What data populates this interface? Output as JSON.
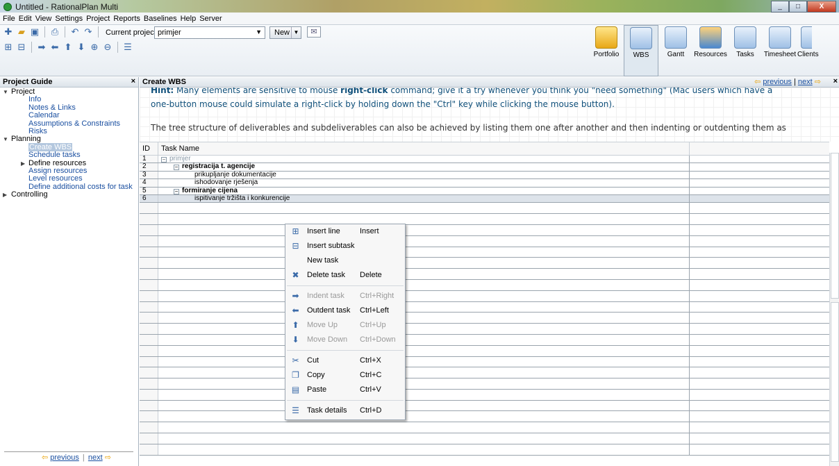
{
  "window": {
    "title": "Untitled - RationalPlan Multi",
    "minimize": "_",
    "maximize": "□",
    "close": "X"
  },
  "menu": [
    "File",
    "Edit",
    "View",
    "Settings",
    "Project",
    "Reports",
    "Baselines",
    "Help",
    "Server"
  ],
  "toolbar": {
    "current_project_label": "Current project:",
    "current_project_value": "primjer",
    "new_label": "New"
  },
  "views": [
    {
      "id": "portfolio",
      "label": "Portfolio"
    },
    {
      "id": "wbs",
      "label": "WBS"
    },
    {
      "id": "gantt",
      "label": "Gantt"
    },
    {
      "id": "resources",
      "label": "Resources"
    },
    {
      "id": "tasks",
      "label": "Tasks"
    },
    {
      "id": "timesheet",
      "label": "Timesheet"
    },
    {
      "id": "clients",
      "label": "Clients"
    }
  ],
  "project_guide": {
    "title": "Project Guide",
    "close": "×",
    "sections": [
      {
        "label": "Project",
        "items": [
          "Info",
          "Notes & Links",
          "Calendar",
          "Assumptions & Constraints",
          "Risks"
        ]
      },
      {
        "label": "Planning",
        "items": [
          "Create WBS",
          "Schedule tasks",
          "Define resources",
          "Assign resources",
          "Level resources",
          "Define additional costs for task"
        ]
      },
      {
        "label": "Controlling",
        "items": []
      }
    ],
    "nav": {
      "previous": "previous",
      "next": "next",
      "separator": "|"
    }
  },
  "main": {
    "title": "Create WBS",
    "nav": {
      "previous": "previous",
      "next": "next",
      "separator": "|"
    },
    "close": "×",
    "hint": {
      "prefix": "Hint:",
      "text_a": " Many elements are sensitive to mouse ",
      "bold": "right-click",
      "text_b": " command; give it a try whenever you think you \"need something\" (Mac users which have a",
      "line2": "one-button mouse could simulate a right-click by holding down the \"Ctrl\" key while clicking the mouse button).",
      "line3": "The tree structure of deliverables and subdeliverables can also be achieved by listing them one after another and then indenting or outdenting them as"
    }
  },
  "grid": {
    "headers": {
      "id": "ID",
      "name": "Task Name"
    },
    "rows": [
      {
        "id": "1",
        "name": "primjer"
      },
      {
        "id": "2",
        "name": "registracija t. agencije"
      },
      {
        "id": "3",
        "name": "prikupljanje dokumentacije"
      },
      {
        "id": "4",
        "name": "ishodovanje rješenja"
      },
      {
        "id": "5",
        "name": "formiranje cijena"
      },
      {
        "id": "6",
        "name": "ispitivanje tržišta i konkurencije"
      }
    ]
  },
  "context_menu": [
    {
      "label": "Insert line",
      "shortcut": "Insert",
      "icon": "insert-line-icon"
    },
    {
      "label": "Insert subtask",
      "shortcut": "",
      "icon": "insert-subtask-icon"
    },
    {
      "label": "New task",
      "shortcut": "",
      "icon": ""
    },
    {
      "label": "Delete task",
      "shortcut": "Delete",
      "icon": "delete-icon"
    },
    {
      "label": "Indent task",
      "shortcut": "Ctrl+Right",
      "icon": "indent-icon"
    },
    {
      "label": "Outdent task",
      "shortcut": "Ctrl+Left",
      "icon": "outdent-icon"
    },
    {
      "label": "Move Up",
      "shortcut": "Ctrl+Up",
      "icon": "move-up-icon"
    },
    {
      "label": "Move Down",
      "shortcut": "Ctrl+Down",
      "icon": "move-down-icon"
    },
    {
      "label": "Cut",
      "shortcut": "Ctrl+X",
      "icon": "cut-icon"
    },
    {
      "label": "Copy",
      "shortcut": "Ctrl+C",
      "icon": "copy-icon"
    },
    {
      "label": "Paste",
      "shortcut": "Ctrl+V",
      "icon": "paste-icon"
    },
    {
      "label": "Task details",
      "shortcut": "Ctrl+D",
      "icon": "task-details-icon"
    }
  ]
}
